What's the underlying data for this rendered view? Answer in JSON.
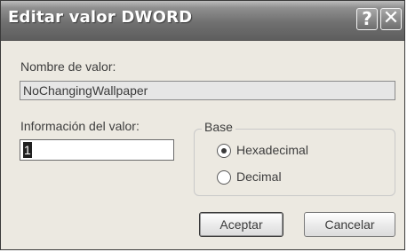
{
  "window": {
    "title": "Editar valor DWORD",
    "help_glyph": "?",
    "close_glyph": "✕"
  },
  "value_name": {
    "label": "Nombre de valor:",
    "value": "NoChangingWallpaper"
  },
  "value_data": {
    "label": "Información del valor:",
    "value": "1"
  },
  "base": {
    "legend": "Base",
    "options": [
      {
        "label": "Hexadecimal",
        "selected": true
      },
      {
        "label": "Decimal",
        "selected": false
      }
    ]
  },
  "buttons": {
    "ok_label": "Aceptar",
    "cancel_label": "Cancelar"
  }
}
